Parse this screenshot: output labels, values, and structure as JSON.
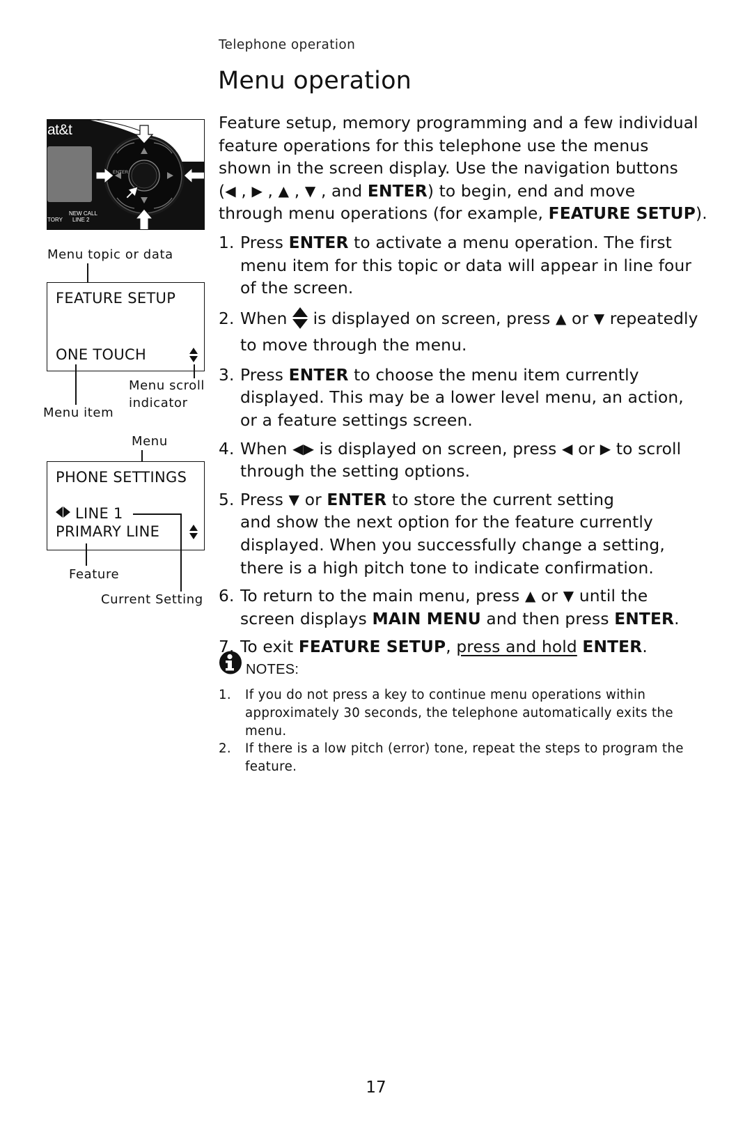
{
  "header": {
    "section": "Telephone operation",
    "title": "Menu operation"
  },
  "intro": {
    "lines": [
      "Feature setup, memory programming and a few individual",
      "feature operations for this telephone use the menus",
      "shown in the screen display. Use the navigation buttons"
    ],
    "nav_open": "(",
    "nav_left": "◀",
    "nav_right": "▶",
    "nav_up": "▲",
    "nav_down": "▼",
    "nav_sep": " , ",
    "nav_and": " , and ",
    "nav_enter": "ENTER",
    "nav_after": ") to begin, end and move",
    "last_pre": "through menu operations (for example, ",
    "last_bold": "FEATURE SETUP",
    "last_post": ")."
  },
  "steps": [
    {
      "num": "1.",
      "pre": "Press ",
      "bold": "ENTER",
      "line1_post": " to activate a menu operation. The first",
      "line2": "menu item for this topic or data will appear in line four",
      "line3": "of the screen."
    },
    {
      "num": "2.",
      "pre": "When ",
      "mid1": " is displayed on screen, press ",
      "up": "▲",
      "or": " or ",
      "down": "▼",
      "post": " repeatedly",
      "line2": "to move through the menu."
    },
    {
      "num": "3.",
      "pre": "Press ",
      "bold": "ENTER",
      "line1_post": " to choose the menu item currently",
      "line2": "displayed. This may be a lower level menu, an action,",
      "line3": "or a feature settings screen."
    },
    {
      "num": "4.",
      "pre": "When ",
      "lr": "◀▶",
      "mid1": " is displayed on screen, press ",
      "left": "◀",
      "or": " or ",
      "right": "▶",
      "post": " to scroll",
      "line2": "through the setting options."
    },
    {
      "num": "5.",
      "pre": "Press ",
      "down": "▼",
      "or": " or ",
      "bold": "ENTER",
      "line1_post": " to store the current setting",
      "line2": "and show the next option for the feature currently",
      "line3": "displayed. When you successfully change a setting,",
      "line4": "there is a high pitch tone to indicate confirmation."
    },
    {
      "num": "6.",
      "pre": "To return to the main menu, press ",
      "up": "▲",
      "or": " or ",
      "down": "▼",
      "post": " until the",
      "line2_pre": "screen displays ",
      "line2_bold": "MAIN MENU",
      "line2_mid": " and then press ",
      "line2_bold2": "ENTER",
      "line2_post": "."
    },
    {
      "num": "7.",
      "pre": "To exit ",
      "bold": "FEATURE SETUP",
      "comma": ", ",
      "underline": "press and hold",
      "space": " ",
      "bold2": "ENTER",
      "post": "."
    }
  ],
  "notes": {
    "icon": "info-icon",
    "label": "NOTES:",
    "items": [
      {
        "num": "1.",
        "lines": [
          "If you do not press a key to continue menu operations within",
          "approximately 30 seconds, the telephone automatically exits the",
          "menu."
        ]
      },
      {
        "num": "2.",
        "lines": [
          "If there is a low pitch (error) tone, repeat the steps to program the",
          "feature."
        ]
      }
    ]
  },
  "diagram": {
    "device": {
      "brand": "at&t",
      "enter_label": "ENTER",
      "key_left_label": "TORY",
      "key_new_call": "NEW CALL",
      "key_line2": "LINE 2"
    },
    "screen1": {
      "callout_top": "Menu topic or data",
      "row1": "FEATURE SETUP",
      "row2": "ONE TOUCH",
      "callout_item": "Menu item",
      "callout_scroll_1": "Menu scroll",
      "callout_scroll_2": "indicator"
    },
    "screen2": {
      "callout_top": "Menu",
      "row1": "PHONE SETTINGS",
      "row2": "LINE 1",
      "row3": "PRIMARY LINE",
      "callout_feature": "Feature",
      "callout_setting": "Current Setting"
    }
  },
  "footer": {
    "page_number": "17"
  }
}
